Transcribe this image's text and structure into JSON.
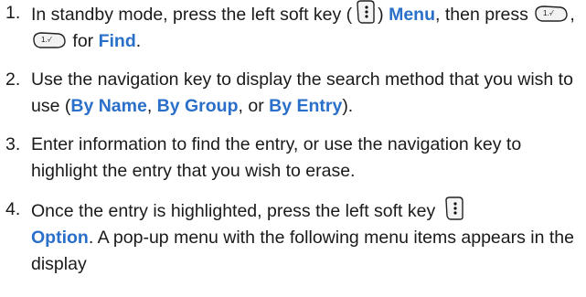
{
  "steps": [
    {
      "num": "1.",
      "t1": "In standby mode, press the left soft key (",
      "t2": ") ",
      "menu": "Menu",
      "t3": ", then press",
      "t4": ",",
      "t5": " for ",
      "find": "Find",
      "t6": "."
    },
    {
      "num": "2.",
      "t1": "Use the navigation key to display the search method that you wish to use (",
      "opt1": "By Name",
      "t2": ", ",
      "opt2": "By Group",
      "t3": ", or ",
      "opt3": "By Entry",
      "t4": ")."
    },
    {
      "num": "3.",
      "t1": "Enter information to find the entry, or use the navigation key to highlight the entry that you wish to erase."
    },
    {
      "num": "4.",
      "t1": "Once the entry is highlighted, press the left soft key",
      "option": "Option",
      "t2": ". A pop-up menu with the following menu items appears in the display"
    }
  ],
  "icons": {
    "soft_key": "left-soft-key-icon",
    "number_key": "number-1-key-icon",
    "number_key_label": "1.-⁄"
  },
  "colors": {
    "highlight": "#2a6fc9",
    "text": "#1a1a1a"
  }
}
